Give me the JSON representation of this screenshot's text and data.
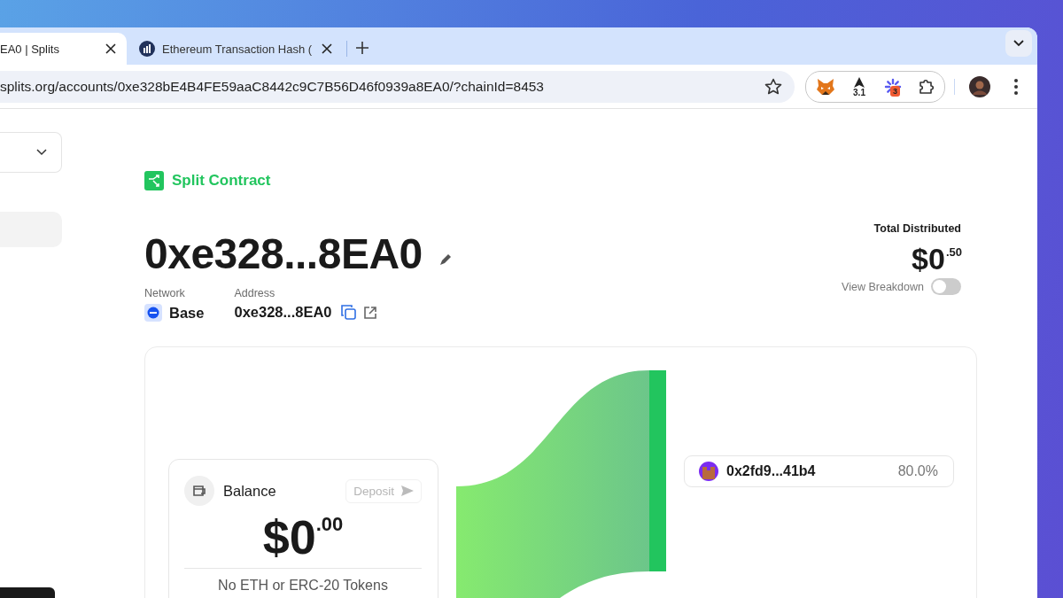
{
  "browser": {
    "tabs": [
      {
        "title": "EA0 | Splits",
        "selected": true,
        "favicon": false
      },
      {
        "title": "Ethereum Transaction Hash (",
        "selected": false,
        "favicon": true
      }
    ],
    "url": "splits.org/accounts/0xe328bE4B4FE59aaC8442c9C7B56D46f0939a8EA0/?chainId=8453",
    "extensions": [
      {
        "kind": "fox"
      },
      {
        "kind": "arrow",
        "badge": "3.1"
      },
      {
        "kind": "spinner",
        "badge": "3"
      },
      {
        "kind": "puzzle"
      }
    ]
  },
  "page": {
    "badge": "Split Contract",
    "title": "0xe328...8EA0",
    "network": {
      "label": "Network",
      "value": "Base"
    },
    "address": {
      "label": "Address",
      "value": "0xe328...8EA0"
    },
    "total": {
      "label": "Total Distributed",
      "whole": "$0",
      "cents": ".50"
    },
    "breakdown": {
      "label": "View Breakdown",
      "on": false
    },
    "balance": {
      "title": "Balance",
      "deposit": "Deposit",
      "whole": "$0",
      "cents": ".00",
      "empty": "No ETH or ERC-20 Tokens"
    },
    "recipients": [
      {
        "address": "0x2fd9...41b4",
        "share": "80.0%"
      }
    ]
  }
}
